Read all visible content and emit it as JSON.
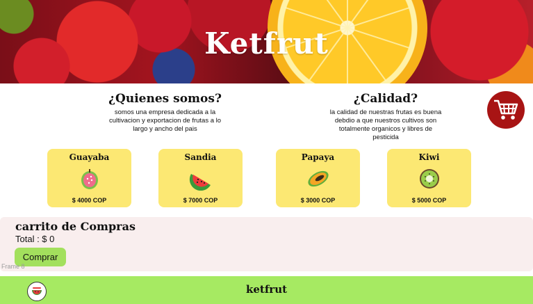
{
  "hero": {
    "title": "Ketfrut"
  },
  "about": {
    "heading": "¿Quienes somos?",
    "text": "somos una empresa dedicada a la cultivacion y exportacion de frutas a lo largo y ancho del pais"
  },
  "quality": {
    "heading": "¿Calidad?",
    "text": "la calidad de nuestras frutas es buena debdio a que nuestros cultivos son totalmente organicos y libres de pesticida"
  },
  "cart_button": {
    "icon": "shopping-cart-icon",
    "color": "#a81414"
  },
  "products": [
    {
      "name": "Guayaba",
      "price": "$ 4000 COP",
      "icon": "guava-icon"
    },
    {
      "name": "Sandia",
      "price": "$ 7000 COP",
      "icon": "watermelon-icon"
    },
    {
      "name": "Papaya",
      "price": "$ 3000 COP",
      "icon": "papaya-icon"
    },
    {
      "name": "Kiwi",
      "price": "$ 5000 COP",
      "icon": "kiwi-icon"
    }
  ],
  "cart": {
    "title": "carrito de Compras",
    "total": "Total : $ 0",
    "buy_label": "Comprar"
  },
  "frame_label": "Frame 8",
  "footer": {
    "name": "ketfrut",
    "logo_icon": "fruit-logo-icon"
  },
  "colors": {
    "card": "#fce873",
    "footer": "#a6ea62",
    "buy_button": "#a3e05d",
    "cart_panel": "#f9eeee"
  }
}
